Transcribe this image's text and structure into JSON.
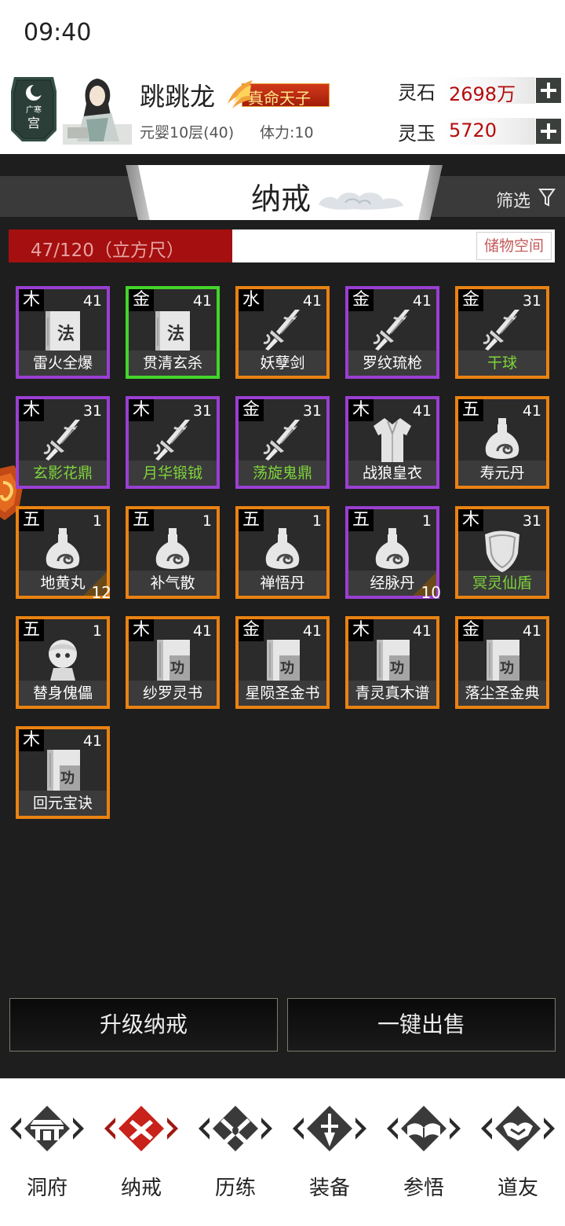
{
  "status": {
    "time": "09:40"
  },
  "player": {
    "name": "跳跳龙",
    "title_badge": "真命天子",
    "level": "元婴10层(40)",
    "stamina": "体力:10",
    "emblem_text": "广寒宫",
    "currencies": [
      {
        "label": "灵石",
        "value": "2698万"
      },
      {
        "label": "灵玉",
        "value": "5720"
      }
    ]
  },
  "tab": {
    "title": "纳戒",
    "filter_label": "筛选"
  },
  "capacity": {
    "text": "47/120（立方尺）",
    "used": 47,
    "total": 120,
    "storage_button": "储物空间"
  },
  "items": [
    {
      "element": "木",
      "level": "41",
      "name": "雷火全爆",
      "rarity": "purple",
      "icon": "technique-scroll-icon",
      "green_name": false
    },
    {
      "element": "金",
      "level": "41",
      "name": "贯清玄杀",
      "rarity": "green",
      "icon": "technique-scroll-icon",
      "green_name": false
    },
    {
      "element": "水",
      "level": "41",
      "name": "妖孽剑",
      "rarity": "orange",
      "icon": "sword-icon",
      "green_name": false
    },
    {
      "element": "金",
      "level": "41",
      "name": "罗纹琉枪",
      "rarity": "purple",
      "icon": "sword-icon",
      "green_name": false
    },
    {
      "element": "金",
      "level": "31",
      "name": "干球",
      "rarity": "orange",
      "icon": "sword-icon",
      "green_name": true
    },
    {
      "element": "木",
      "level": "31",
      "name": "玄影花鼎",
      "rarity": "purple",
      "icon": "sword-icon",
      "green_name": true
    },
    {
      "element": "木",
      "level": "31",
      "name": "月华锻钺",
      "rarity": "purple",
      "icon": "sword-icon",
      "green_name": true
    },
    {
      "element": "金",
      "level": "31",
      "name": "荡旋鬼鼎",
      "rarity": "purple",
      "icon": "sword-icon",
      "green_name": true
    },
    {
      "element": "木",
      "level": "41",
      "name": "战狼皇衣",
      "rarity": "purple",
      "icon": "robe-icon",
      "green_name": false
    },
    {
      "element": "五",
      "level": "41",
      "name": "寿元丹",
      "rarity": "orange",
      "icon": "pill-gourd-icon",
      "green_name": false
    },
    {
      "element": "五",
      "level": "1",
      "name": "地黄丸",
      "rarity": "orange",
      "icon": "pill-gourd-icon",
      "green_name": false,
      "count": "12"
    },
    {
      "element": "五",
      "level": "1",
      "name": "补气散",
      "rarity": "orange",
      "icon": "pill-gourd-icon",
      "green_name": false
    },
    {
      "element": "五",
      "level": "1",
      "name": "禅悟丹",
      "rarity": "orange",
      "icon": "pill-gourd-icon",
      "green_name": false
    },
    {
      "element": "五",
      "level": "1",
      "name": "经脉丹",
      "rarity": "purple",
      "icon": "pill-gourd-icon",
      "green_name": false,
      "count": "10"
    },
    {
      "element": "木",
      "level": "31",
      "name": "冥灵仙盾",
      "rarity": "orange",
      "icon": "shield-icon",
      "green_name": true
    },
    {
      "element": "五",
      "level": "1",
      "name": "替身傀儡",
      "rarity": "orange",
      "icon": "doll-icon",
      "green_name": false
    },
    {
      "element": "木",
      "level": "41",
      "name": "纱罗灵书",
      "rarity": "orange",
      "icon": "skill-book-icon",
      "green_name": false
    },
    {
      "element": "金",
      "level": "41",
      "name": "星陨圣金书",
      "rarity": "orange",
      "icon": "skill-book-icon",
      "green_name": false
    },
    {
      "element": "木",
      "level": "41",
      "name": "青灵真木谱",
      "rarity": "orange",
      "icon": "skill-book-icon",
      "green_name": false
    },
    {
      "element": "金",
      "level": "41",
      "name": "落尘圣金典",
      "rarity": "orange",
      "icon": "skill-book-icon",
      "green_name": false
    },
    {
      "element": "木",
      "level": "41",
      "name": "回元宝诀",
      "rarity": "orange",
      "icon": "skill-book-icon",
      "green_name": false
    }
  ],
  "actions": {
    "upgrade": "升级纳戒",
    "sell_all": "一键出售"
  },
  "nav": [
    {
      "label": "洞府",
      "icon": "gate-icon",
      "active": false
    },
    {
      "label": "纳戒",
      "icon": "close-x-icon",
      "active": true
    },
    {
      "label": "历练",
      "icon": "crossed-swords-icon",
      "active": false
    },
    {
      "label": "装备",
      "icon": "sword-down-icon",
      "active": false
    },
    {
      "label": "参悟",
      "icon": "open-book-icon",
      "active": false
    },
    {
      "label": "道友",
      "icon": "handshake-icon",
      "active": false
    }
  ],
  "colors": {
    "orange": "#e98212",
    "purple": "#9a3fd2",
    "green": "#43d52b",
    "accent_red": "#a50f0f",
    "green_text": "#7ed43b"
  }
}
